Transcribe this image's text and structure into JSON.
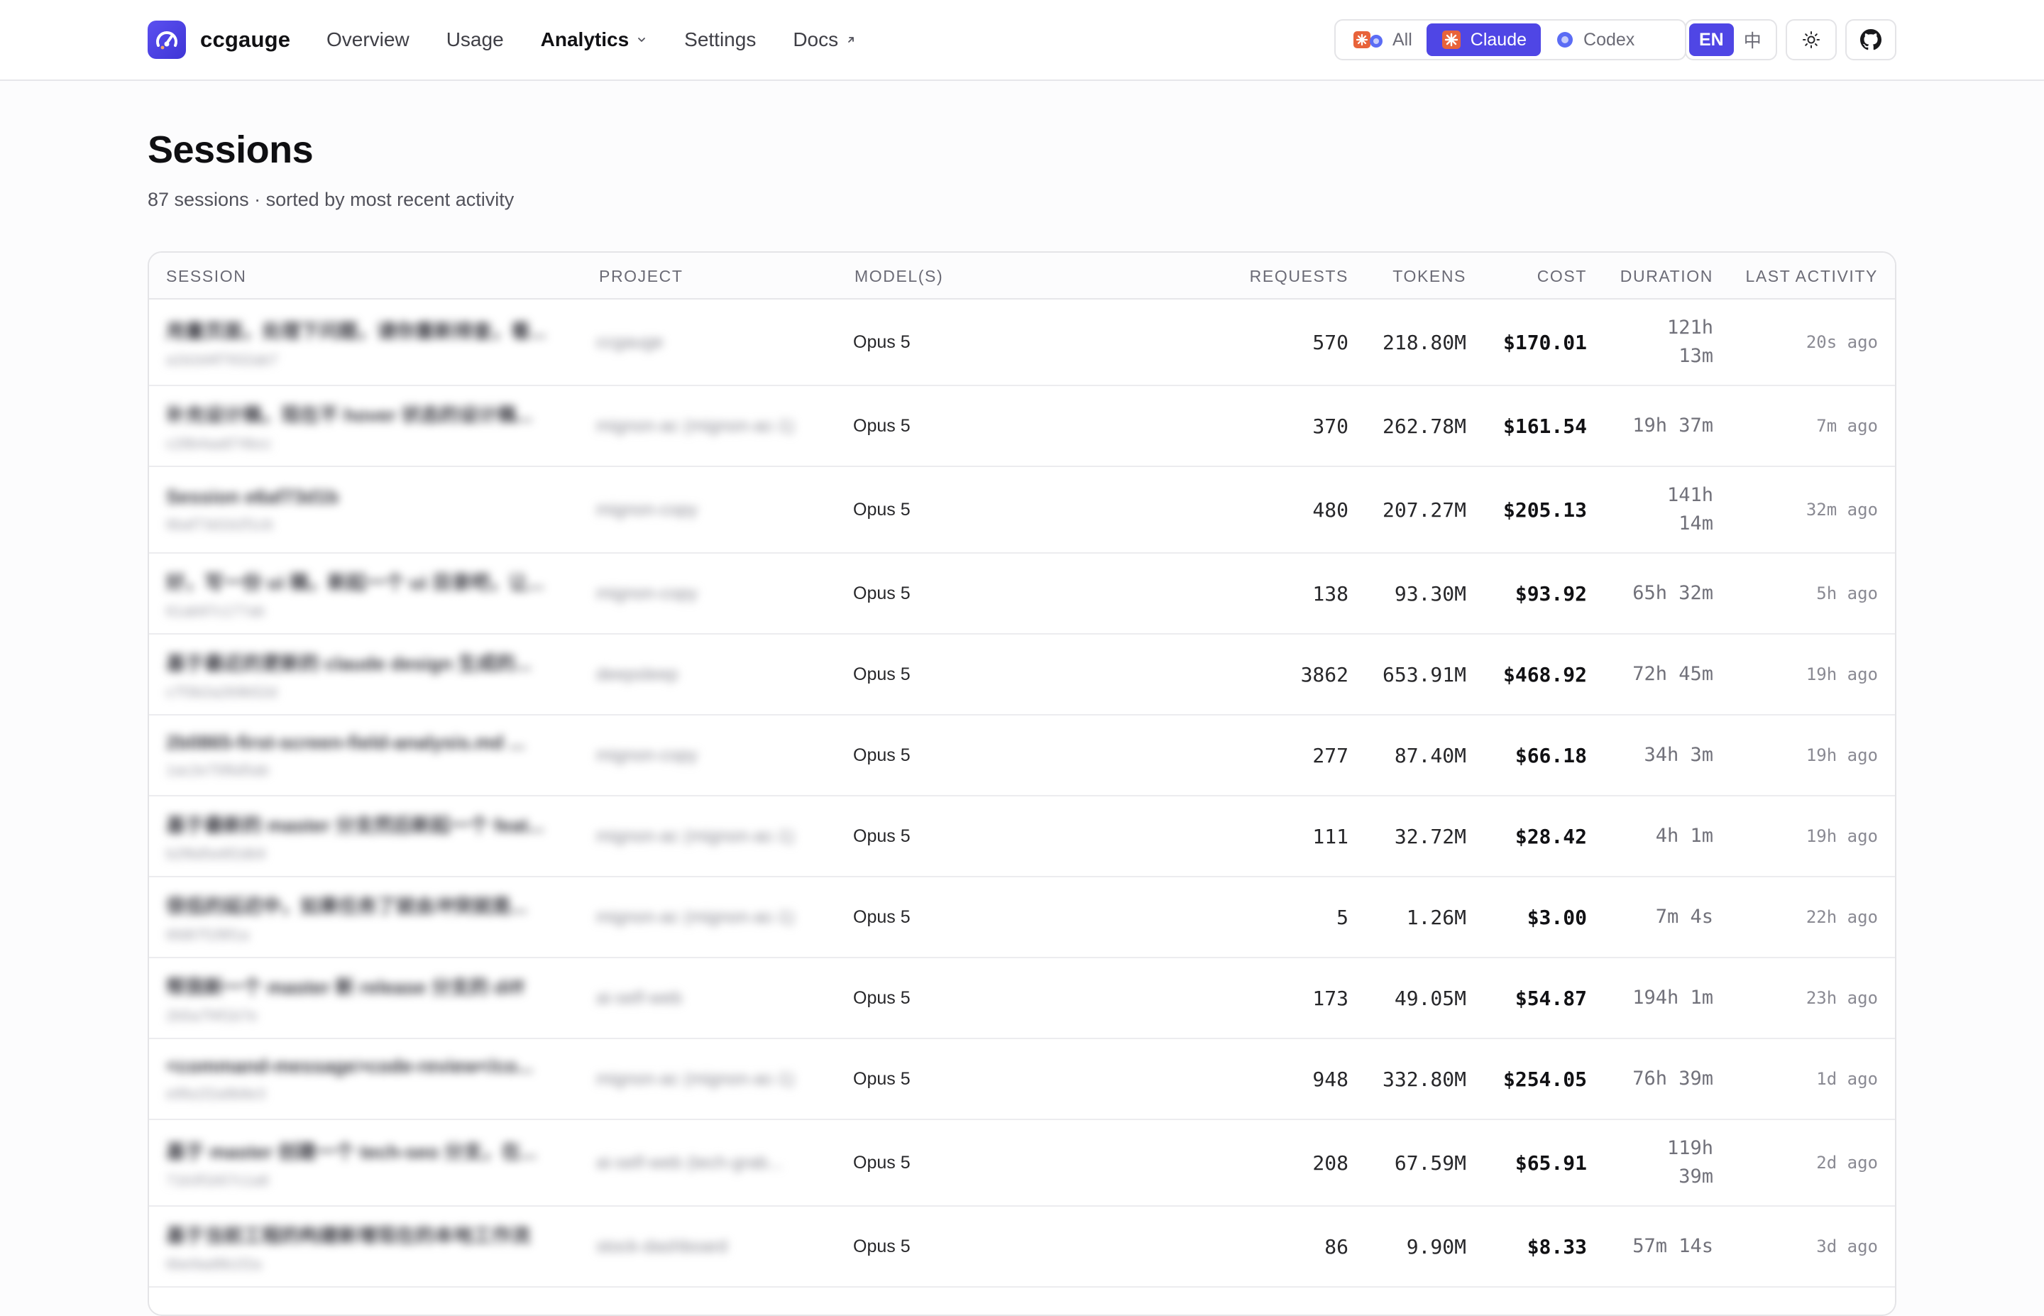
{
  "brand": {
    "name": "ccgauge"
  },
  "nav": {
    "overview": "Overview",
    "usage": "Usage",
    "analytics": "Analytics",
    "settings": "Settings",
    "docs": "Docs"
  },
  "provider_switch": {
    "all": "All",
    "claude": "Claude",
    "codex": "Codex",
    "selected": "Claude"
  },
  "language_switch": {
    "en": "EN",
    "zh": "中",
    "selected": "EN"
  },
  "colors": {
    "accent": "#4f46e5",
    "claude_orange": "#e8633a",
    "codex_blue": "#5b6cf5"
  },
  "page": {
    "title": "Sessions",
    "subtitle": "87 sessions · sorted by most recent activity"
  },
  "table": {
    "headers": {
      "session": "SESSION",
      "project": "PROJECT",
      "models": "MODEL(S)",
      "requests": "REQUESTS",
      "tokens": "TOKENS",
      "cost": "COST",
      "duration": "DURATION",
      "last_activity": "LAST ACTIVITY"
    },
    "rows": [
      {
        "title": "用量页面，处理下问题，请你重新排查，看...",
        "session_id": "a1b2d4f7932ab7",
        "project": "ccgauge",
        "model": "Opus 5",
        "requests": "570",
        "tokens": "218.80M",
        "cost": "$170.01",
        "duration_1": "121h",
        "duration_2": "13m",
        "last": "20s ago"
      },
      {
        "title": "补充设计稿，现在不 hover 状态的设计稿...",
        "session_id": "c28b4aa874bcc",
        "project": "mignon-ac (mignon-ac-1)",
        "model": "Opus 5",
        "requests": "370",
        "tokens": "262.78M",
        "cost": "$161.54",
        "duration_1": "19h 37m",
        "duration_2": "",
        "last": "7m ago"
      },
      {
        "title": "Session e6af73d1b",
        "session_id": "6baf73d1b2f1cb",
        "project": "mignon-copy",
        "model": "Opus 5",
        "requests": "480",
        "tokens": "207.27M",
        "cost": "$205.13",
        "duration_1": "141h",
        "duration_2": "14m",
        "last": "32m ago"
      },
      {
        "title": "好，写一份 ui 稿，新起一个 ui 目录吧，让...",
        "session_id": "61ab97c177ab",
        "project": "mignon-copy",
        "model": "Opus 5",
        "requests": "138",
        "tokens": "93.30M",
        "cost": "$93.92",
        "duration_1": "65h 32m",
        "duration_2": "",
        "last": "5h ago"
      },
      {
        "title": "基于最近的更新的 claude design 生成的...",
        "session_id": "c7f3b2a269b52d",
        "project": "deepsleep",
        "model": "Opus 5",
        "requests": "3862",
        "tokens": "653.91M",
        "cost": "$468.92",
        "duration_1": "72h 45m",
        "duration_2": "",
        "last": "19h ago"
      },
      {
        "title": "2b0865-first-screen-field-analysis.md ...",
        "session_id": "1ac2e75f6d5ab",
        "project": "mignon-copy",
        "model": "Opus 5",
        "requests": "277",
        "tokens": "87.40M",
        "cost": "$66.18",
        "duration_1": "34h 3m",
        "duration_2": "",
        "last": "19h ago"
      },
      {
        "title": "基于最新的 master 分支然后新起一个 feat...",
        "session_id": "b2f8d5e8f2db9",
        "project": "mignon-ac (mignon-ac-1)",
        "model": "Opus 5",
        "requests": "111",
        "tokens": "32.72M",
        "cost": "$28.42",
        "duration_1": "4h 1m",
        "duration_2": "",
        "last": "19h ago"
      },
      {
        "title": "很低的延迟中，如果任务了就会冲突就是...",
        "session_id": "6fd87f1f8f1a",
        "project": "mignon-ac (mignon-ac-1)",
        "model": "Opus 5",
        "requests": "5",
        "tokens": "1.26M",
        "cost": "$3.00",
        "duration_1": "7m 4s",
        "duration_2": "",
        "last": "22h ago"
      },
      {
        "title": "帮我新一个 master 新 release 分支的 diff",
        "session_id": "2b5a7f4f1b7e",
        "project": "ai-self-web",
        "model": "Opus 5",
        "requests": "173",
        "tokens": "49.05M",
        "cost": "$54.87",
        "duration_1": "194h 1m",
        "duration_2": "",
        "last": "23h ago"
      },
      {
        "title": "<command-message>code-review</co...",
        "session_id": "e9fa1f2a9b8e3",
        "project": "mignon-ac (mignon-ac-1)",
        "model": "Opus 5",
        "requests": "948",
        "tokens": "332.80M",
        "cost": "$254.05",
        "duration_1": "76h 39m",
        "duration_2": "",
        "last": "1d ago"
      },
      {
        "title": "基于 master 创建一个 tech-seo 分支，在...",
        "session_id": "71b3f1b57c1a8",
        "project": "ai-self-web (tech-grab...",
        "model": "Opus 5",
        "requests": "208",
        "tokens": "67.59M",
        "cost": "$65.91",
        "duration_1": "119h",
        "duration_2": "39m",
        "last": "2d ago"
      },
      {
        "title": "基于当前工程的构建新增现在的本地工作流",
        "session_id": "6be9ad8b1f2a",
        "project": "stock-dashboard",
        "model": "Opus 5",
        "requests": "86",
        "tokens": "9.90M",
        "cost": "$8.33",
        "duration_1": "57m 14s",
        "duration_2": "",
        "last": "3d ago"
      }
    ]
  }
}
